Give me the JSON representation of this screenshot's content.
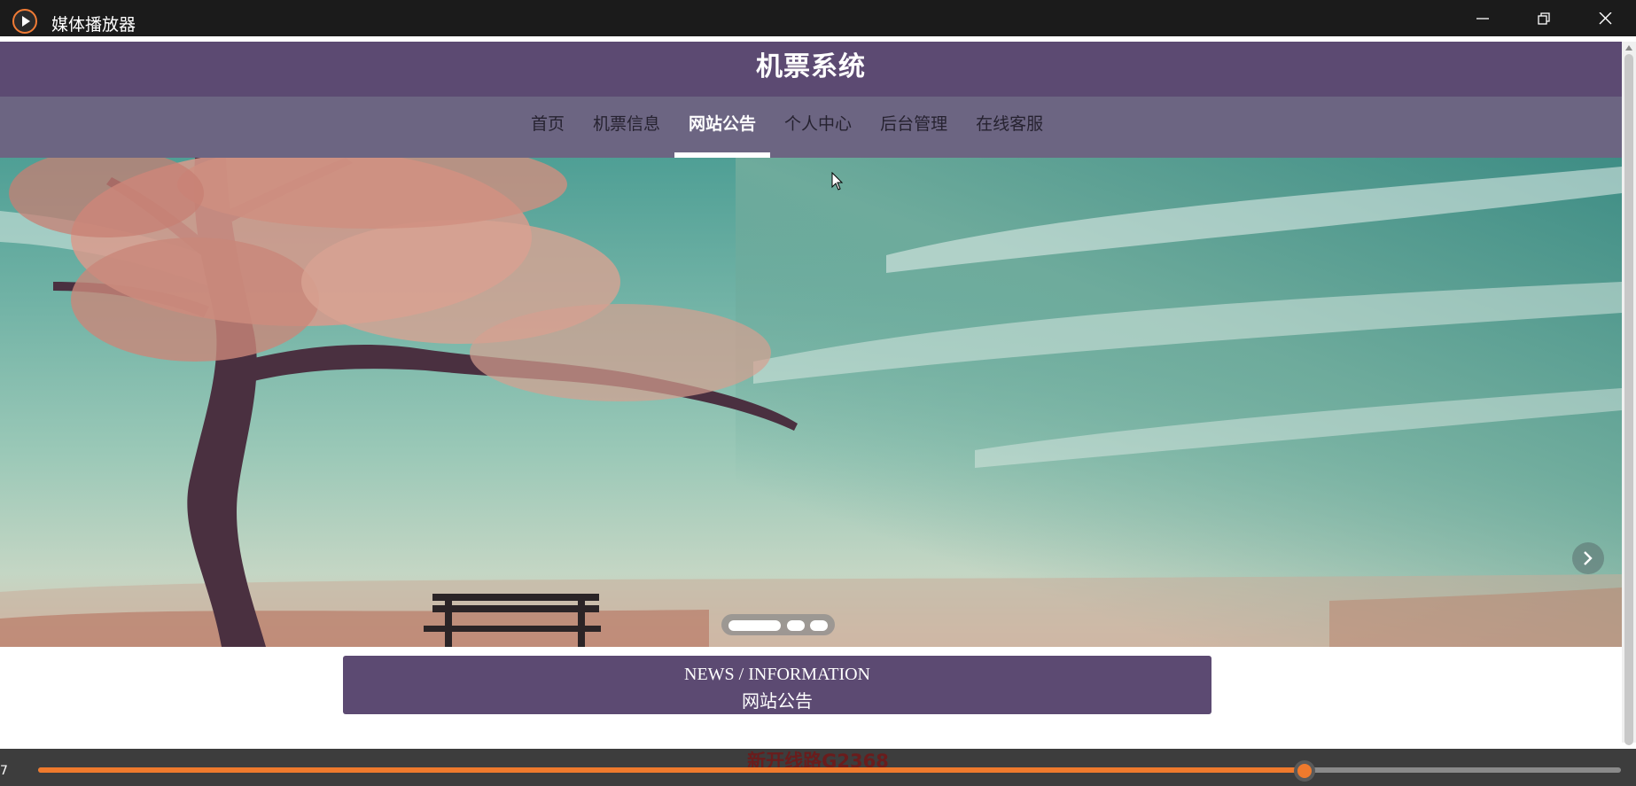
{
  "window": {
    "title": "媒体播放器",
    "icon": "media-player-icon",
    "controls": [
      "minimize-icon",
      "restore-icon",
      "close-icon"
    ]
  },
  "site": {
    "title": "机票系统",
    "nav": [
      {
        "label": "首页",
        "active": false
      },
      {
        "label": "机票信息",
        "active": false
      },
      {
        "label": "网站公告",
        "active": true
      },
      {
        "label": "个人中心",
        "active": false
      },
      {
        "label": "后台管理",
        "active": false
      },
      {
        "label": "在线客服",
        "active": false
      }
    ]
  },
  "banner": {
    "slide_count": 3,
    "active_slide": 1,
    "next_icon": "chevron-right-icon"
  },
  "news": {
    "en": "NEWS / INFORMATION",
    "cn": "网站公告"
  },
  "player": {
    "ticker": "新开线路G2368",
    "time_left": "7",
    "progress": 0.8
  },
  "colors": {
    "header": "#5c4a72",
    "nav": "#6c6582",
    "accent": "#ef7a2d"
  }
}
